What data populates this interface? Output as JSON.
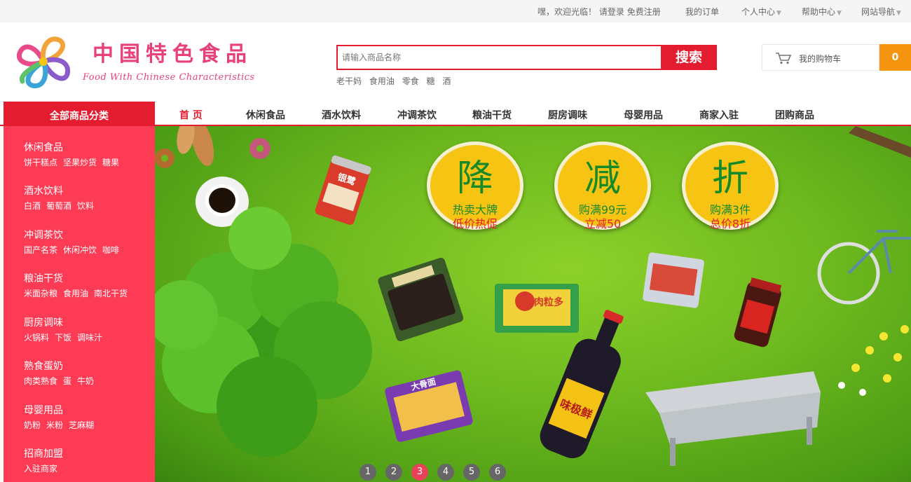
{
  "topbar": {
    "welcome": "嘿，欢迎光临！",
    "login": "请登录",
    "register": "免费注册",
    "my_orders": "我的订单",
    "user_center": "个人中心",
    "help_center": "帮助中心",
    "site_nav": "网站导航"
  },
  "logo": {
    "title_cn": "中国特色食品",
    "title_en": "Food With Chinese Characteristics"
  },
  "search": {
    "placeholder": "请输入商品名称",
    "button": "搜索",
    "hot_words": [
      "老干妈",
      "食用油",
      "零食",
      "糖",
      "酒"
    ]
  },
  "cart": {
    "label": "我的购物车",
    "count": "0"
  },
  "nav": {
    "category_title": "全部商品分类",
    "items": [
      "首 页",
      "休闲食品",
      "酒水饮料",
      "冲调茶饮",
      "粮油干货",
      "厨房调味",
      "母婴用品",
      "商家入驻",
      "团购商品"
    ],
    "active_index": 0
  },
  "sidebar": {
    "categories": [
      {
        "title": "休闲食品",
        "subs": [
          "饼干糕点",
          "坚果炒货",
          "糖果"
        ]
      },
      {
        "title": "酒水饮料",
        "subs": [
          "白酒",
          "葡萄酒",
          "饮料"
        ]
      },
      {
        "title": "冲调茶饮",
        "subs": [
          "国产名茶",
          "休闲冲饮",
          "咖啡"
        ]
      },
      {
        "title": "粮油干货",
        "subs": [
          "米面杂粮",
          "食用油",
          "南北干货"
        ]
      },
      {
        "title": "厨房调味",
        "subs": [
          "火锅料",
          "下饭",
          "调味汁"
        ]
      },
      {
        "title": "熟食蛋奶",
        "subs": [
          "肉类熟食",
          "蛋",
          "牛奶"
        ]
      },
      {
        "title": "母婴用品",
        "subs": [
          "奶粉",
          "米粉",
          "芝麻糊"
        ]
      },
      {
        "title": "招商加盟",
        "subs": [
          "入驻商家"
        ]
      }
    ]
  },
  "banner": {
    "promos": [
      {
        "big": "降",
        "line1": "热卖大牌",
        "line2": "低价热促"
      },
      {
        "big": "减",
        "line1": "购满99元",
        "line2": "立减50"
      },
      {
        "big": "折",
        "line1": "购满3件",
        "line2": "总价8折"
      }
    ],
    "products": {
      "meat": "肉粒多",
      "soy_sauce": "味极鲜",
      "porridge": "银鹭",
      "noodles": "大骨面"
    },
    "pager": [
      "1",
      "2",
      "3",
      "4",
      "5",
      "6"
    ],
    "active_page": 3
  },
  "colors": {
    "accent_red": "#e41c2f",
    "sidebar_red": "#fe3b55",
    "cart_orange": "#f5950f",
    "promo_yellow": "#f7c413",
    "promo_green": "#158a2a",
    "brand_pink": "#e8407a"
  },
  "icons": {
    "cart": "shopping-cart-icon",
    "caret": "caret-down-icon",
    "logo": "flower-logo-icon"
  }
}
